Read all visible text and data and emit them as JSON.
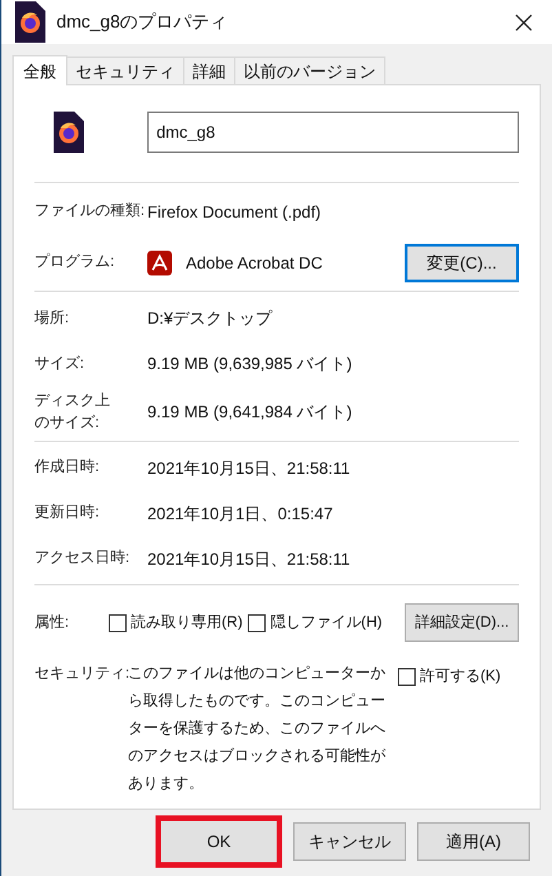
{
  "window": {
    "title": "dmc_g8のプロパティ"
  },
  "tabs": [
    {
      "label": "全般",
      "selected": true
    },
    {
      "label": "セキュリティ",
      "selected": false
    },
    {
      "label": "詳細",
      "selected": false
    },
    {
      "label": "以前のバージョン",
      "selected": false
    }
  ],
  "name_field": {
    "value": "dmc_g8"
  },
  "file_type": {
    "label": "ファイルの種類:",
    "value": "Firefox Document (.pdf)"
  },
  "program": {
    "label": "プログラム:",
    "value": "Adobe Acrobat DC",
    "button": "変更(C)..."
  },
  "location_group": [
    {
      "label_lines": [
        "場所:"
      ],
      "value": "D:¥デスクトップ"
    },
    {
      "label_lines": [
        "サイズ:"
      ],
      "value": "9.19 MB (9,639,985 バイト)"
    },
    {
      "label_lines": [
        "ディスク上",
        "のサイズ:"
      ],
      "value": "9.19 MB (9,641,984 バイト)"
    }
  ],
  "dates": [
    {
      "label": "作成日時:",
      "value": "2021年10月15日、21:58:11"
    },
    {
      "label": "更新日時:",
      "value": "2021年10月1日、0:15:47"
    },
    {
      "label": "アクセス日時:",
      "value": "2021年10月15日、21:58:11"
    }
  ],
  "attributes": {
    "label": "属性:",
    "checkboxes": [
      {
        "label": "読み取り専用(R)",
        "checked": false
      },
      {
        "label": "隠しファイル(H)",
        "checked": false
      }
    ],
    "button": "詳細設定(D)..."
  },
  "security": {
    "label": "セキュリティ:",
    "text": "このファイルは他のコンピューターから取得したものです。このコンピューターを保護するため、このファイルへのアクセスはブロックされる可能性があります。",
    "checkbox": {
      "label": "許可する(K)",
      "checked": false
    }
  },
  "buttons": [
    {
      "label": "OK",
      "highlighted": true
    },
    {
      "label": "キャンセル",
      "highlighted": false
    },
    {
      "label": "適用(A)",
      "highlighted": false
    }
  ]
}
